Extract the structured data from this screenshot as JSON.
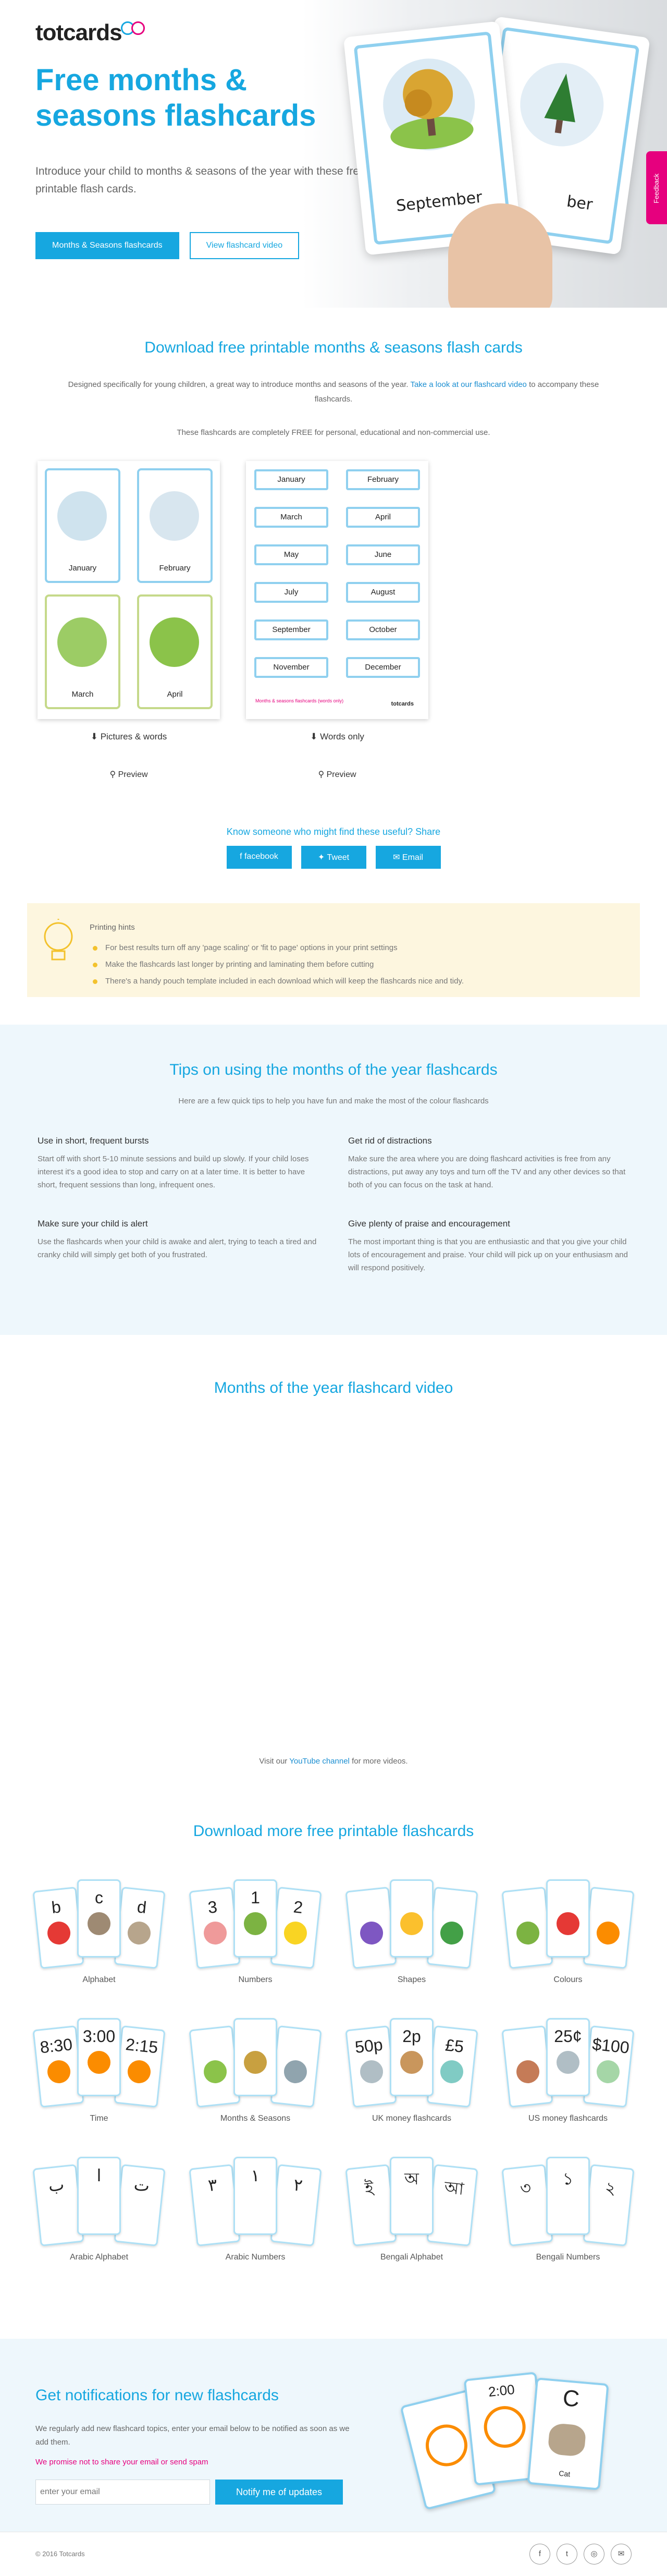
{
  "header": {
    "logo": "totcards",
    "title": "Free months & seasons flashcards",
    "lead": "Introduce your child to months & seasons of the year with these free printable flash cards.",
    "primary_button": "Months & Seasons flashcards",
    "secondary_button": "View flashcard video",
    "hero_card_front": "September",
    "hero_card_back": "ber",
    "feedback_tab": "Feedback"
  },
  "download": {
    "title": "Download free printable months & seasons flash cards",
    "intro": "Designed specifically for young children, a great way to introduce months and seasons of the year.",
    "intro_link": "Take a look at our flashcard video",
    "intro_end": "to accompany these flashcards.",
    "free_note": "These flashcards are completely FREE for personal, educational and non-commercial use.",
    "sheet_pictures": {
      "cards": [
        "January",
        "February",
        "March",
        "April"
      ],
      "download_label": "Pictures & words",
      "preview_label": "Preview"
    },
    "sheet_words": {
      "months": [
        "January",
        "February",
        "March",
        "April",
        "May",
        "June",
        "July",
        "August",
        "September",
        "October",
        "November",
        "December"
      ],
      "footer_title": "Months & seasons flashcards (words only)",
      "footer_logo": "totcards",
      "download_label": "Words only",
      "preview_label": "Preview"
    },
    "share_title": "Know someone who might find these useful? Share",
    "share_buttons": [
      "facebook",
      "Tweet",
      "Email"
    ]
  },
  "hints": {
    "title": "Printing hints",
    "items": [
      "For best results turn off any 'page scaling' or 'fit to page' options in your print settings",
      "Make the flashcards last longer by printing and laminating them before cutting",
      "There's a handy pouch template included in each download which will keep the flashcards nice and tidy."
    ]
  },
  "tips": {
    "title": "Tips on using the months of the year flashcards",
    "subtitle": "Here are a few quick tips to help you have fun and make the most of the colour flashcards",
    "items": [
      {
        "title": "Use in short, frequent bursts",
        "body": "Start off with short 5-10 minute sessions and build up slowly. If your child loses interest it's a good idea to stop and carry on at a later time. It is better to have short, frequent sessions than long, infrequent ones."
      },
      {
        "title": "Get rid of distractions",
        "body": "Make sure the area where you are doing flashcard activities is free from any distractions, put away any toys and turn off the TV and any other devices so that both of you can focus on the task at hand."
      },
      {
        "title": "Make sure your child is alert",
        "body": "Use the flashcards when your child is awake and alert, trying to teach a tired and cranky child will simply get both of you frustrated."
      },
      {
        "title": "Give plenty of praise and encouragement",
        "body": "The most important thing is that you are enthusiastic and that you give your child lots of encouragement and praise. Your child will pick up on your enthusiasm and will respond positively."
      }
    ]
  },
  "video": {
    "title": "Months of the year flashcard video",
    "more_prefix": "Visit our",
    "more_link": "YouTube channel",
    "more_suffix": "for more videos."
  },
  "more": {
    "title": "Download more free printable flashcards",
    "sets": [
      {
        "label": "Alphabet",
        "symbols": [
          "b",
          "c",
          "d"
        ],
        "colors": [
          "#e53935",
          "#9e8a73",
          "#b7a58c"
        ]
      },
      {
        "label": "Numbers",
        "symbols": [
          "3",
          "1",
          "2"
        ],
        "colors": [
          "#ef9a9a",
          "#7cb342",
          "#f9d423"
        ]
      },
      {
        "label": "Shapes",
        "symbols": [
          "",
          "",
          ""
        ],
        "colors": [
          "#7e57c2",
          "#fbc02d",
          "#43a047"
        ]
      },
      {
        "label": "Colours",
        "symbols": [
          "",
          "",
          ""
        ],
        "colors": [
          "#7cb342",
          "#e53935",
          "#fb8c00"
        ]
      },
      {
        "label": "Time",
        "symbols": [
          "8:30",
          "3:00",
          "2:15"
        ],
        "colors": [
          "#fb8c00",
          "#fb8c00",
          "#fb8c00"
        ]
      },
      {
        "label": "Months & Seasons",
        "symbols": [
          "",
          "",
          ""
        ],
        "colors": [
          "#8bc34a",
          "#c8a040",
          "#90a4ae"
        ]
      },
      {
        "label": "UK money flashcards",
        "symbols": [
          "50p",
          "2p",
          "£5"
        ],
        "colors": [
          "#b0bec5",
          "#c9965c",
          "#80cbc4"
        ]
      },
      {
        "label": "US money flashcards",
        "symbols": [
          "",
          "25¢",
          "$100"
        ],
        "colors": [
          "#c57b57",
          "#b0bec5",
          "#a5d6a7"
        ]
      },
      {
        "label": "Arabic Alphabet",
        "symbols": [
          "ب",
          "ا",
          "ت"
        ],
        "colors": [
          "#ffffff",
          "#ffffff",
          "#ffffff"
        ]
      },
      {
        "label": "Arabic Numbers",
        "symbols": [
          "٣",
          "١",
          "٢"
        ],
        "colors": [
          "#ffffff",
          "#ffffff",
          "#ffffff"
        ]
      },
      {
        "label": "Bengali Alphabet",
        "symbols": [
          "ই",
          "অ",
          "আ"
        ],
        "colors": [
          "#ffffff",
          "#ffffff",
          "#ffffff"
        ]
      },
      {
        "label": "Bengali Numbers",
        "symbols": [
          "৩",
          "১",
          "২"
        ],
        "colors": [
          "#ffffff",
          "#ffffff",
          "#ffffff"
        ]
      }
    ]
  },
  "notify": {
    "title": "Get notifications for new flashcards",
    "desc": "We regularly add new flashcard topics, enter your email below to be notified as soon as we add them.",
    "promise": "We promise not to share your email or send spam",
    "email_placeholder": "enter your email",
    "submit": "Notify me of updates",
    "card_numbers": [
      "2:00",
      "C",
      "Cat"
    ]
  },
  "footer": {
    "copyright": "© 2016 Totcards",
    "socials": [
      "f",
      "t",
      "◎",
      "✉"
    ]
  },
  "colors": {
    "accent": "#16a7e0",
    "pink": "#e6007e",
    "hint_bg": "#fdf6df",
    "tips_bg": "#eef7fc"
  }
}
